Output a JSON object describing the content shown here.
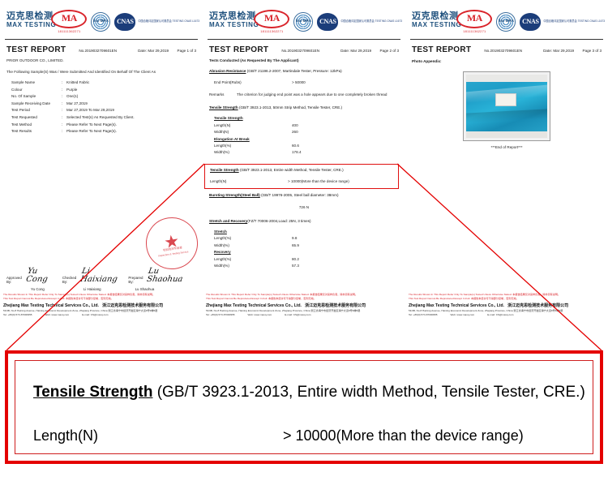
{
  "brand": {
    "name_cn": "迈克思检测",
    "name_en": "MAX TESTING",
    "cma_label": "MA",
    "cma_number": "181111362271",
    "ilac_label": "ilac-MRA",
    "cnas_label": "CNAS",
    "cnas_sub": "中国合格评定国家认可委员会 TESTING CNAS L1673"
  },
  "pages": [
    {
      "title": "TEST REPORT",
      "report_no": "No.2019032709601EN",
      "date": "Date: Mar 29,2019",
      "page_label": "Page  1  of  3",
      "client": "PRIOR OUTDOOR CO., LIMITED.",
      "subline": "The Following Sample(S) Was / Were Submitted And Identified On Behalf Of The Client As",
      "info": [
        {
          "key": "Sample Name",
          "value": "Knitted Fabric"
        },
        {
          "key": "Colour",
          "value": "Purple"
        },
        {
          "key": "No. Of Sample",
          "value": "One(1)"
        },
        {
          "key": "Sample Receiving Date",
          "value": "Mar 27,2019"
        },
        {
          "key": "Test Period",
          "value": "Mar 27,2019 To Mar 29,2019"
        },
        {
          "key": "Test Requested",
          "value": "Selected Test(s) As Requested By Client."
        },
        {
          "key": "Test Method",
          "value": "Please Refer To Next Page(s)."
        },
        {
          "key": "Test Results",
          "value": "Please Refer To Next Page(s)."
        }
      ]
    },
    {
      "title": "TEST REPORT",
      "report_no": "No.2019032709601EN",
      "date": "Date: Mar 29,2019",
      "page_label": "Page  2  of  3",
      "subline": "Tests Conducted (As Requested By The Applicant)",
      "abrasion": {
        "heading": "Abrasion Resistance",
        "standard": "(GB/T 21196.2-2007, Martindale Tester, Pressure: 12kPa)",
        "rows": [
          {
            "key": "End Point(Rubs)",
            "value": "> 50000"
          }
        ],
        "remarks_label": "Remarks",
        "remarks_text": "The criterion for judging end point was a hole appears due to one completely broken thread"
      },
      "tensile_strip": {
        "heading": "Tensile Strength",
        "standard": "(GB/T 3923.1-2013, 50mm Strip Method, Tensile Tester, CRE.)",
        "group1": "Tensile Strength",
        "rows1": [
          {
            "key": "Length(N)",
            "value": "400"
          },
          {
            "key": "Width(N)",
            "value": "260"
          }
        ],
        "group2": "Elongation At Break",
        "rows2": [
          {
            "key": "Length(%)",
            "value": "60.6"
          },
          {
            "key": "Width(%)",
            "value": "178.4"
          }
        ]
      },
      "tensile_entire": {
        "heading": "Tensile Strength",
        "standard": "(GB/T 3923.1-2013, Entire width Method, Tensile Tester, CRE.)",
        "rows": [
          {
            "key": "Length(N)",
            "value": "> 10000(More than the device range)"
          }
        ]
      },
      "bursting": {
        "heading": "Bursting Strength(Steel Ball)",
        "standard": "(GB/T 19976-2005, Steel ball diameter: 38mm)",
        "value": "726 N"
      },
      "stretch": {
        "heading": "Stretch and Recovery",
        "standard": "(FZ/T 70006-2004,Load: 25N, 3 times)",
        "group1": "Stretch",
        "rows1": [
          {
            "key": "Length(%)",
            "value": "9.8"
          },
          {
            "key": "Width(%)",
            "value": "65.9"
          }
        ],
        "group2": "Recovery",
        "rows2": [
          {
            "key": "Length(%)",
            "value": "80.2"
          },
          {
            "key": "Width(%)",
            "value": "57.3"
          }
        ]
      }
    },
    {
      "title": "TEST REPORT",
      "report_no": "No.2019032709601EN",
      "date": "Date: Mar 29,2019",
      "page_label": "Page  3  of  3",
      "photo_label": "Photo Appendix:",
      "end_of_report": "***End of Report***"
    }
  ],
  "signatures": {
    "approved_label": "Approved By:",
    "approved_script": "Yu Cong",
    "approved_name": "Yu Cong",
    "checked_label": "Checked By:",
    "checked_script": "Li Haixiang",
    "checked_name": "Li Haixiang",
    "prepared_label": "Prepared By:",
    "prepared_script": "Lu Shaohua",
    "prepared_name": "Lu Shaohua"
  },
  "stamp": {
    "top_text": "浙江迈克思检测技术服务有限公司",
    "line1": "检验检测专用章",
    "line2": "Inspection & Testing Service"
  },
  "footer": {
    "red_line1": "The Results Shown In This Report Refer Only To Sample(s) Tested Unless Otherwise Stated. 本报告结果仅对来样负责，除非另有说明。",
    "red_line2": "This Test Report Cannot Be Reproduced Except In Full. 本报告未经许可不得部分复制，否则无效。",
    "company": "Zhejiang Max Testing Technical Services Co., Ltd.",
    "company_cn": "浙江迈克思检测技术服务有限公司",
    "address": "5F,9B, No.8 Haining Avenue, Haining Economic Development Zone, Zhejiang Province, China   浙江省海宁市经济开发区海宁大道8号9幢5层",
    "tel": "Tel: +86(0) 573-87000955",
    "web": "Web: www.maxq.com",
    "email": "E-mail: CS@maxq.com"
  },
  "callout": {
    "heading": "Tensile Strength",
    "standard": " (GB/T 3923.1-2013, Entire width Method, Tensile Tester, CRE.)",
    "key": "Length(N)",
    "value": "> 10000(More than the device range)"
  },
  "colors": {
    "accent_red": "#e40000",
    "brand_blue": "#1d4f7c",
    "cma_red": "#d9232a"
  }
}
